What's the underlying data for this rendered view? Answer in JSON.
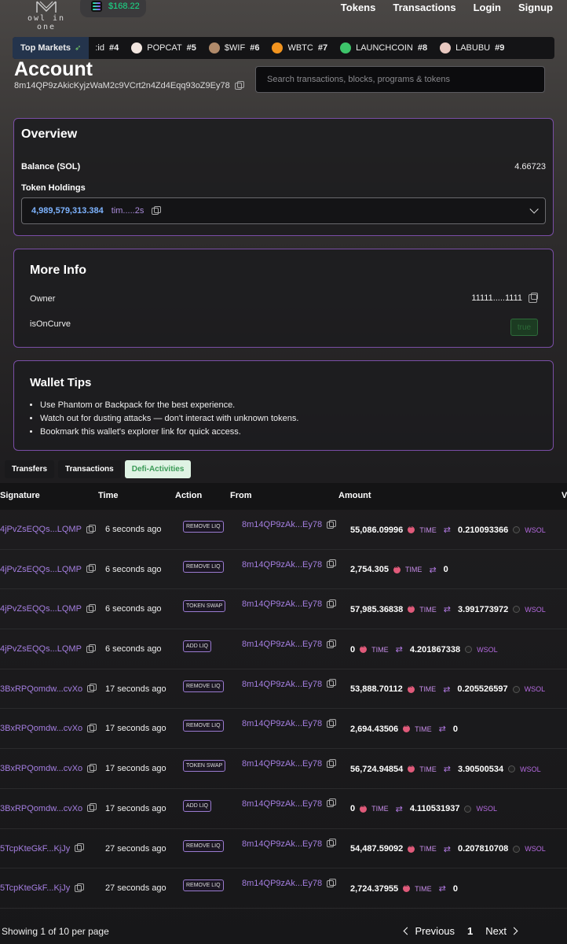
{
  "header": {
    "logo_text": "owl in one",
    "sol_price": "$168.22",
    "nav": [
      "Tokens",
      "Transactions",
      "Login",
      "Signup"
    ]
  },
  "ticker": {
    "label": "Top Markets",
    "items": [
      {
        "name": ":id",
        "rank": "#4",
        "color": ""
      },
      {
        "name": "POPCAT",
        "rank": "#5",
        "color": "#f2e6e0"
      },
      {
        "name": "$WIF",
        "rank": "#6",
        "color": "#b08a6a"
      },
      {
        "name": "WBTC",
        "rank": "#7",
        "color": "#f2941f"
      },
      {
        "name": "LAUNCHCOIN",
        "rank": "#8",
        "color": "#3dc46a"
      },
      {
        "name": "LABUBU",
        "rank": "#9",
        "color": "#e8c8c0"
      }
    ]
  },
  "account": {
    "title": "Account",
    "address": "8m14QP9zAkicKyjzWaM2c9VCrt2n4Zd4Eqq93oZ9Ey78"
  },
  "search": {
    "placeholder": "Search transactions, blocks, programs & tokens"
  },
  "overview": {
    "title": "Overview",
    "balance_label": "Balance (SOL)",
    "balance_value": "4.66723",
    "holdings_label": "Token Holdings",
    "holding_amount": "4,989,579,313.384",
    "holding_token": "tim.....2s"
  },
  "more_info": {
    "title": "More Info",
    "owner_label": "Owner",
    "owner_value": "11111.....1111",
    "curve_label": "isOnCurve",
    "curve_value": "true"
  },
  "wallet_tips": {
    "title": "Wallet Tips",
    "items": [
      "Use Phantom or Backpack for the best experience.",
      "Watch out for dusting attacks — don't interact with unknown tokens.",
      "Bookmark this wallet's explorer link for quick access."
    ]
  },
  "tabs": [
    "Transfers",
    "Transactions",
    "Defi-Activities"
  ],
  "table": {
    "headers": [
      "Signature",
      "Time",
      "Action",
      "From",
      "Amount",
      "V"
    ],
    "rows": [
      {
        "sig": "4jPvZsEQQs...LQMP",
        "time": "6 seconds ago",
        "action": "REMOVE LIQ",
        "from": "8m14QP9zAk...Ey78",
        "amt1": "55,086.09996",
        "tok1": "TIME",
        "amt2": "0.210093366",
        "tok2": "WSOL"
      },
      {
        "sig": "4jPvZsEQQs...LQMP",
        "time": "6 seconds ago",
        "action": "REMOVE LIQ",
        "from": "8m14QP9zAk...Ey78",
        "amt1": "2,754.305",
        "tok1": "TIME",
        "amt2": "0",
        "tok2": ""
      },
      {
        "sig": "4jPvZsEQQs...LQMP",
        "time": "6 seconds ago",
        "action": "TOKEN SWAP",
        "from": "8m14QP9zAk...Ey78",
        "amt1": "57,985.36838",
        "tok1": "TIME",
        "amt2": "3.991773972",
        "tok2": "WSOL"
      },
      {
        "sig": "4jPvZsEQQs...LQMP",
        "time": "6 seconds ago",
        "action": "ADD LIQ",
        "from": "8m14QP9zAk...Ey78",
        "amt1": "0",
        "tok1": "TIME",
        "amt2": "4.201867338",
        "tok2": "WSOL"
      },
      {
        "sig": "3BxRPQomdw...cvXo",
        "time": "17 seconds ago",
        "action": "REMOVE LIQ",
        "from": "8m14QP9zAk...Ey78",
        "amt1": "53,888.70112",
        "tok1": "TIME",
        "amt2": "0.205526597",
        "tok2": "WSOL"
      },
      {
        "sig": "3BxRPQomdw...cvXo",
        "time": "17 seconds ago",
        "action": "REMOVE LIQ",
        "from": "8m14QP9zAk...Ey78",
        "amt1": "2,694.43506",
        "tok1": "TIME",
        "amt2": "0",
        "tok2": ""
      },
      {
        "sig": "3BxRPQomdw...cvXo",
        "time": "17 seconds ago",
        "action": "TOKEN SWAP",
        "from": "8m14QP9zAk...Ey78",
        "amt1": "56,724.94854",
        "tok1": "TIME",
        "amt2": "3.90500534",
        "tok2": "WSOL"
      },
      {
        "sig": "3BxRPQomdw...cvXo",
        "time": "17 seconds ago",
        "action": "ADD LIQ",
        "from": "8m14QP9zAk...Ey78",
        "amt1": "0",
        "tok1": "TIME",
        "amt2": "4.110531937",
        "tok2": "WSOL"
      },
      {
        "sig": "5TcpKteGkF...KjJy",
        "time": "27 seconds ago",
        "action": "REMOVE LIQ",
        "from": "8m14QP9zAk...Ey78",
        "amt1": "54,487.59092",
        "tok1": "TIME",
        "amt2": "0.207810708",
        "tok2": "WSOL"
      },
      {
        "sig": "5TcpKteGkF...KjJy",
        "time": "27 seconds ago",
        "action": "REMOVE LIQ",
        "from": "8m14QP9zAk...Ey78",
        "amt1": "2,724.37955",
        "tok1": "TIME",
        "amt2": "0",
        "tok2": ""
      }
    ]
  },
  "pagination": {
    "summary": "Showing 1 of 10 per page",
    "previous": "Previous",
    "page": "1",
    "next": "Next"
  }
}
